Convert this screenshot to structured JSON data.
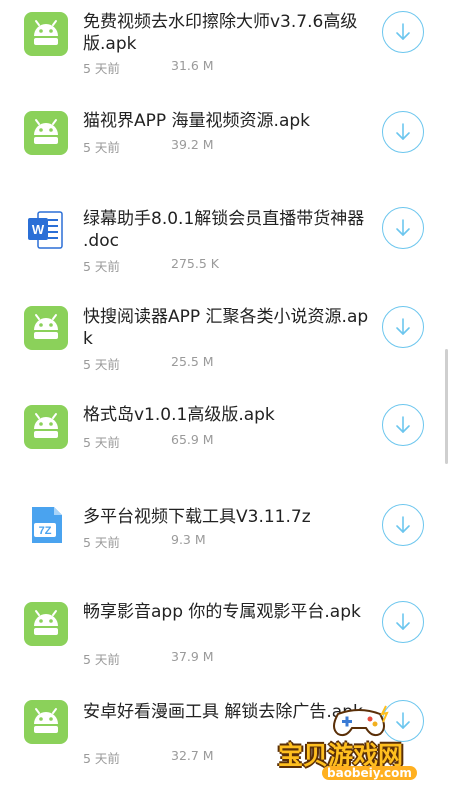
{
  "files": [
    {
      "title": "免费视频去水印擦除大师v3.7.6高级版.apk",
      "date": "5 天前",
      "size": "31.6 M",
      "icon": "android-icon"
    },
    {
      "title": "猫视界APP 海量视频资源.apk",
      "date": "5 天前",
      "size": "39.2 M",
      "icon": "android-icon"
    },
    {
      "title": "绿幕助手8.0.1解锁会员直播带货神器 .doc",
      "date": "5 天前",
      "size": "275.5 K",
      "icon": "word-doc-icon"
    },
    {
      "title": "快搜阅读器APP 汇聚各类小说资源.apk",
      "date": "5 天前",
      "size": "25.5 M",
      "icon": "android-icon"
    },
    {
      "title": "格式岛v1.0.1高级版.apk",
      "date": "5 天前",
      "size": "65.9 M",
      "icon": "android-icon"
    },
    {
      "title": "多平台视频下载工具V3.11.7z",
      "date": "5 天前",
      "size": "9.3 M",
      "icon": "7z-archive-icon"
    },
    {
      "title": "畅享影音app 你的专属观影平台.apk",
      "date": "5 天前",
      "size": "37.9 M",
      "icon": "android-icon"
    },
    {
      "title": "安卓好看漫画工具 解锁去除广告.apk",
      "date": "5 天前",
      "size": "32.7 M",
      "icon": "android-icon"
    }
  ],
  "watermark": {
    "text": "宝贝游戏网",
    "url": "baobeiy.com"
  },
  "colors": {
    "android_green": "#8bd15a",
    "download_blue": "#6cc6ee",
    "word_blue": "#2b6fd6"
  }
}
